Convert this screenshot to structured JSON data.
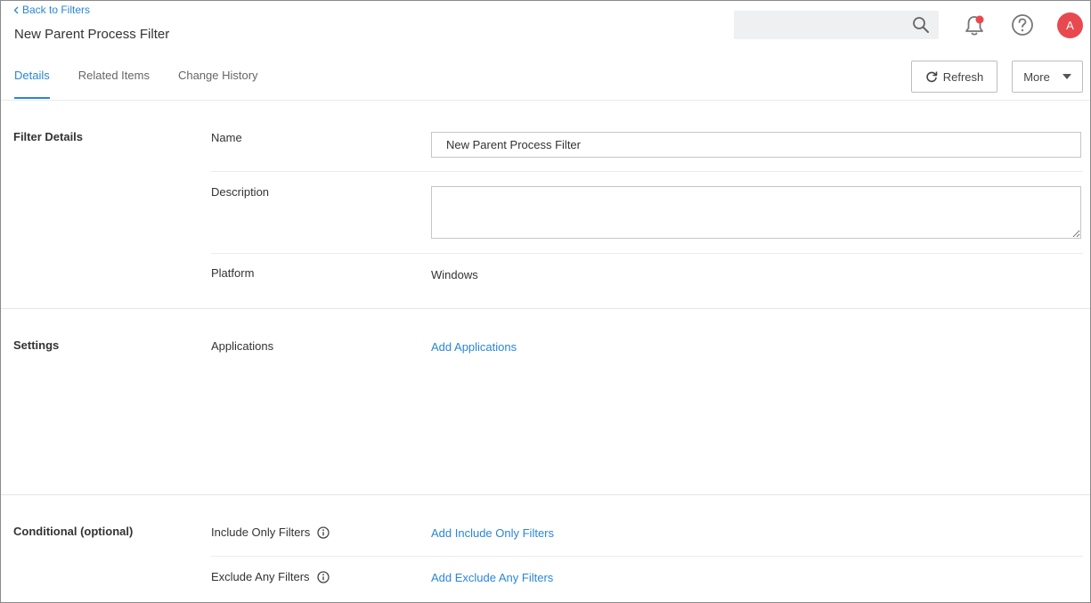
{
  "header": {
    "back_link": "Back to Filters",
    "title": "New Parent Process Filter",
    "search": {
      "value": "",
      "placeholder": ""
    },
    "avatar_initial": "A"
  },
  "tabs": [
    {
      "label": "Details",
      "active": true
    },
    {
      "label": "Related Items",
      "active": false
    },
    {
      "label": "Change History",
      "active": false
    }
  ],
  "toolbar": {
    "refresh_label": "Refresh",
    "more_label": "More"
  },
  "filter_details": {
    "section_title": "Filter Details",
    "name_label": "Name",
    "name_value": "New Parent Process Filter",
    "description_label": "Description",
    "description_value": "",
    "platform_label": "Platform",
    "platform_value": "Windows"
  },
  "settings": {
    "section_title": "Settings",
    "applications_label": "Applications",
    "add_applications": "Add Applications"
  },
  "conditional": {
    "section_title": "Conditional (optional)",
    "include_label": "Include Only Filters",
    "add_include": "Add Include Only Filters",
    "exclude_label": "Exclude Any Filters",
    "add_exclude": "Add Exclude Any Filters"
  },
  "colors": {
    "accent": "#2a86d6",
    "avatar_bg": "#e8494f",
    "notification_dot": "#e8494f"
  },
  "icons": [
    "chevron-left-icon",
    "search-icon",
    "bell-icon",
    "help-icon",
    "refresh-icon",
    "caret-down-icon",
    "info-icon"
  ]
}
